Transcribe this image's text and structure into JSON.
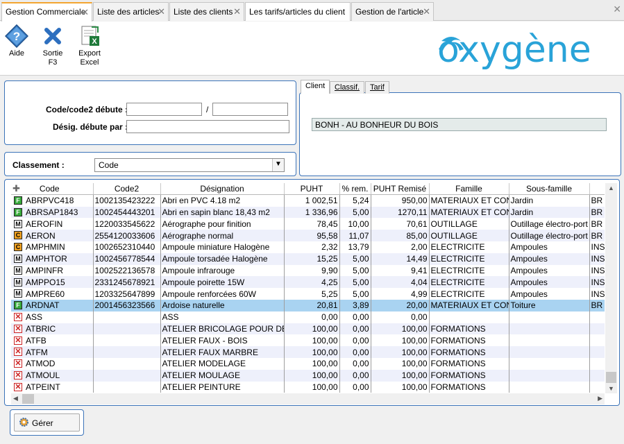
{
  "tabs": [
    {
      "label": "Gestion Commerciale",
      "active": true
    },
    {
      "label": "Liste des articles",
      "active": false
    },
    {
      "label": "Liste des clients",
      "active": false
    },
    {
      "label": "Les tarifs/articles du client",
      "active": false
    },
    {
      "label": "Gestion de l'article",
      "active": false
    }
  ],
  "toolbar": {
    "aide": "Aide",
    "sortie": [
      "Sortie",
      "F3"
    ],
    "export": [
      "Export",
      "Excel"
    ]
  },
  "logo_text": "oxygène",
  "filter": {
    "code_label": "Code/code2 débute :",
    "code_value": "",
    "code2_value": "",
    "separator": "/",
    "desig_label": "Désig. débute par :",
    "desig_value": ""
  },
  "classement": {
    "label": "Classement :",
    "value": "Code"
  },
  "client_tabs": [
    "Client",
    "Classif.",
    "Tarif"
  ],
  "client_value": "BONH - AU BONHEUR DU BOIS",
  "columns": [
    "Code",
    "Code2",
    "Désignation",
    "PUHT",
    "% rem.",
    "PUHT Remisé",
    "Famille",
    "Sous-famille",
    ""
  ],
  "rows": [
    {
      "icon": "F",
      "code": "ABRPVC418",
      "code2": "1002135423222",
      "desig": "Abri en PVC 4.18 m2",
      "puht": "1 002,51",
      "rem": "5,24",
      "remise": "950,00",
      "famille": "MATERIAUX ET CONS",
      "sousfam": "Jardin",
      "extra": "BR"
    },
    {
      "icon": "F",
      "code": "ABRSAP1843",
      "code2": "1002454443201",
      "desig": "Abri en sapin blanc 18,43 m2",
      "puht": "1 336,96",
      "rem": "5,00",
      "remise": "1270,11",
      "famille": "MATERIAUX ET CONS",
      "sousfam": "Jardin",
      "extra": "BR"
    },
    {
      "icon": "M",
      "code": "AEROFIN",
      "code2": "1220033545622",
      "desig": "Aérographe pour finition",
      "puht": "78,45",
      "rem": "10,00",
      "remise": "70,61",
      "famille": "OUTILLAGE",
      "sousfam": "Outillage électro-port",
      "extra": "BR"
    },
    {
      "icon": "C",
      "code": "AERON",
      "code2": "2554120033606",
      "desig": "Aérographe normal",
      "puht": "95,58",
      "rem": "11,07",
      "remise": "85,00",
      "famille": "OUTILLAGE",
      "sousfam": "Outillage électro-port",
      "extra": "BR"
    },
    {
      "icon": "C",
      "code": "AMPHMIN",
      "code2": "1002652310440",
      "desig": "Ampoule miniature Halogène",
      "puht": "2,32",
      "rem": "13,79",
      "remise": "2,00",
      "famille": "ELECTRICITE",
      "sousfam": "Ampoules",
      "extra": "INS"
    },
    {
      "icon": "M",
      "code": "AMPHTOR",
      "code2": "1002456778544",
      "desig": "Ampoule torsadée Halogène",
      "puht": "15,25",
      "rem": "5,00",
      "remise": "14,49",
      "famille": "ELECTRICITE",
      "sousfam": "Ampoules",
      "extra": "INS"
    },
    {
      "icon": "M",
      "code": "AMPINFR",
      "code2": "1002522136578",
      "desig": "Ampoule infrarouge",
      "puht": "9,90",
      "rem": "5,00",
      "remise": "9,41",
      "famille": "ELECTRICITE",
      "sousfam": "Ampoules",
      "extra": "INS"
    },
    {
      "icon": "M",
      "code": "AMPPO15",
      "code2": "2331245678921",
      "desig": "Ampoule poirette 15W",
      "puht": "4,25",
      "rem": "5,00",
      "remise": "4,04",
      "famille": "ELECTRICITE",
      "sousfam": "Ampoules",
      "extra": "INS"
    },
    {
      "icon": "M",
      "code": "AMPRE60",
      "code2": "1203325647899",
      "desig": "Ampoule renforcées 60W",
      "puht": "5,25",
      "rem": "5,00",
      "remise": "4,99",
      "famille": "ELECTRICITE",
      "sousfam": "Ampoules",
      "extra": "INS"
    },
    {
      "icon": "F",
      "code": "ARDNAT",
      "code2": "2001456323566",
      "desig": "Ardoise naturelle",
      "puht": "20,81",
      "rem": "3,89",
      "remise": "20,00",
      "famille": "MATERIAUX ET CONS",
      "sousfam": "Toiture",
      "extra": "BR",
      "selected": true
    },
    {
      "icon": "X",
      "code": "ASS",
      "code2": "",
      "desig": "ASS",
      "puht": "0,00",
      "rem": "0,00",
      "remise": "0,00",
      "famille": "",
      "sousfam": "",
      "extra": ""
    },
    {
      "icon": "X",
      "code": "ATBRIC",
      "code2": "",
      "desig": "ATELIER BRICOLAGE POUR DE",
      "puht": "100,00",
      "rem": "0,00",
      "remise": "100,00",
      "famille": "FORMATIONS",
      "sousfam": "",
      "extra": ""
    },
    {
      "icon": "X",
      "code": "ATFB",
      "code2": "",
      "desig": "ATELIER FAUX - BOIS",
      "puht": "100,00",
      "rem": "0,00",
      "remise": "100,00",
      "famille": "FORMATIONS",
      "sousfam": "",
      "extra": ""
    },
    {
      "icon": "X",
      "code": "ATFM",
      "code2": "",
      "desig": "ATELIER FAUX MARBRE",
      "puht": "100,00",
      "rem": "0,00",
      "remise": "100,00",
      "famille": "FORMATIONS",
      "sousfam": "",
      "extra": ""
    },
    {
      "icon": "X",
      "code": "ATMOD",
      "code2": "",
      "desig": "ATELIER MODELAGE",
      "puht": "100,00",
      "rem": "0,00",
      "remise": "100,00",
      "famille": "FORMATIONS",
      "sousfam": "",
      "extra": ""
    },
    {
      "icon": "X",
      "code": "ATMOUL",
      "code2": "",
      "desig": "ATELIER MOULAGE",
      "puht": "100,00",
      "rem": "0,00",
      "remise": "100,00",
      "famille": "FORMATIONS",
      "sousfam": "",
      "extra": ""
    },
    {
      "icon": "X",
      "code": "ATPEINT",
      "code2": "",
      "desig": "ATELIER PEINTURE",
      "puht": "100,00",
      "rem": "0,00",
      "remise": "100,00",
      "famille": "FORMATIONS",
      "sousfam": "",
      "extra": ""
    }
  ],
  "gerer_label": "Gérer",
  "colors": {
    "accent": "#f3a530",
    "panel_border": "#3b73b9",
    "selection": "#a9d3f1",
    "alt_row": "#eef0fb",
    "logo": "#29a3d8"
  }
}
